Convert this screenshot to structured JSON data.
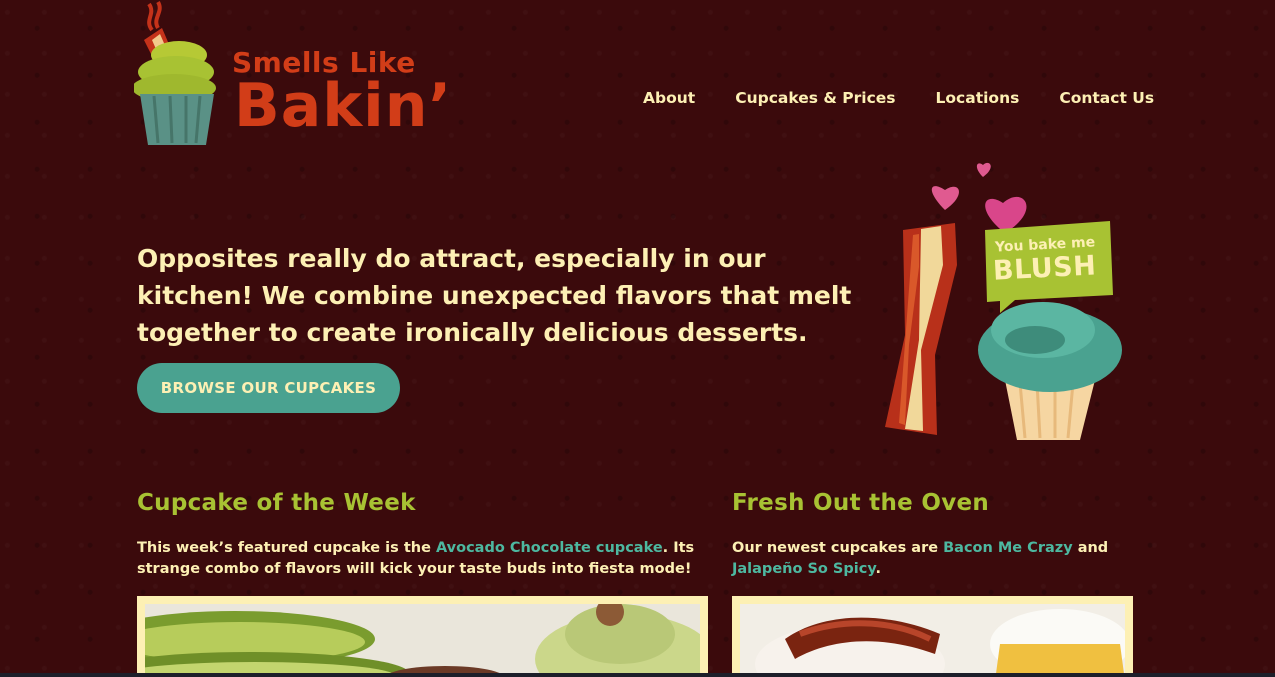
{
  "brand": {
    "name_line1": "Smells Like",
    "name_line2": "Bakin’",
    "primary_color": "#d23d18",
    "background_color": "#3b0a0c",
    "accent_green": "#a8c233",
    "accent_teal": "#4aa290",
    "text_cream": "#fdf0b4"
  },
  "nav": {
    "items": [
      {
        "label": "About"
      },
      {
        "label": "Cupcakes & Prices"
      },
      {
        "label": "Locations"
      },
      {
        "label": "Contact Us"
      }
    ]
  },
  "hero": {
    "tagline": "Opposites really do attract, especially in our kitchen! We combine unexpected flavors that melt together to create ironically delicious desserts.",
    "cta_label": "BROWSE OUR CUPCAKES",
    "bubble_line1": "You bake me",
    "bubble_line2": "BLUSH"
  },
  "cupcake_of_week": {
    "title": "Cupcake of the Week",
    "text_before": "This week’s featured cupcake is the ",
    "link": "Avocado Chocolate cupcake",
    "text_after": ". Its strange combo of flavors will kick your taste buds into fiesta mode!"
  },
  "fresh_out": {
    "title": "Fresh Out the Oven",
    "text_before": "Our newest cupcakes are ",
    "link1": "Bacon Me Crazy",
    "text_middle": " and ",
    "link2": "Jalapeño So Spicy",
    "text_after": "."
  }
}
